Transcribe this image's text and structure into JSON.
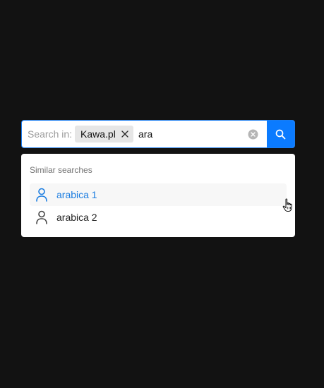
{
  "search": {
    "prefix_label": "Search in:",
    "scope_chip": {
      "label": "Kawa.pl",
      "close_icon": "close-icon"
    },
    "query_value": "ara",
    "placeholder": "",
    "clear_icon": "clear-circle-icon",
    "submit_icon": "search-icon"
  },
  "dropdown": {
    "heading": "Similar searches",
    "items": [
      {
        "label": "arabica 1",
        "icon": "person-icon",
        "state": "hovered"
      },
      {
        "label": "arabica 2",
        "icon": "person-icon",
        "state": "normal"
      }
    ]
  },
  "colors": {
    "background": "#121212",
    "accent": "#0b7bff",
    "highlight_text": "#1a7ce0"
  }
}
